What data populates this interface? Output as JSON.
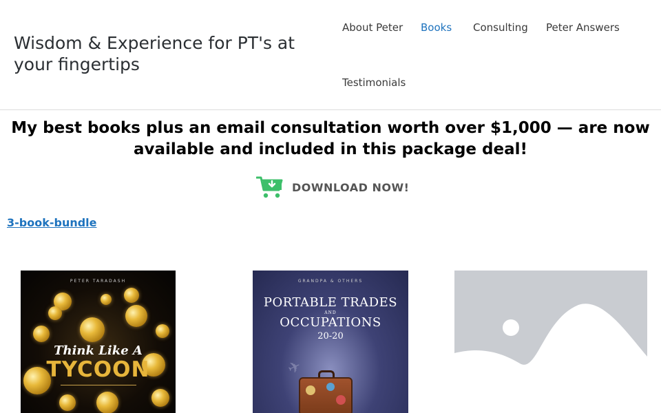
{
  "header": {
    "site_title": "Wisdom & Experience for PT's at your fingertips",
    "nav": [
      {
        "label": "About Peter"
      },
      {
        "label": "Books",
        "active": true
      },
      {
        "label": "Consulting"
      },
      {
        "label": "Peter Answers"
      },
      {
        "label": "Testimonials"
      }
    ],
    "active_color": "#1e73be"
  },
  "main": {
    "headline": "My best books plus an email consultation worth over $1,000 — are now available and included in this package deal!",
    "download": {
      "label": "DOWNLOAD NOW!",
      "icon": "shopping-cart-download-icon",
      "icon_color": "#3dbf6a"
    },
    "bundle_link": "3-book-bundle",
    "books": [
      {
        "cover_author": "PETER TARADASH",
        "title_line1": "Think Like A",
        "title_line2": "TYCOON"
      },
      {
        "cover_author": "GRANDPA & OTHERS",
        "title_line1": "PORTABLE TRADES",
        "title_and": "AND",
        "title_line2": "OCCUPATIONS",
        "title_year": "20-20"
      },
      {
        "image": "placeholder-image-icon"
      }
    ]
  }
}
